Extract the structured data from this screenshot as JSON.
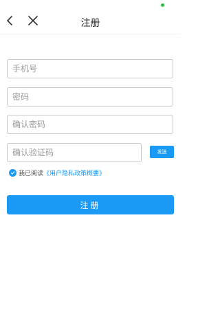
{
  "colors": {
    "accent": "#1a9af5",
    "status_dot": "#2fbf3f"
  },
  "header": {
    "title": "注册",
    "back_icon": "chevron-left-icon",
    "close_icon": "close-icon"
  },
  "form": {
    "phone_placeholder": "手机号",
    "password_placeholder": "密码",
    "confirm_password_placeholder": "确认密码",
    "verification_code_placeholder": "确认验证码",
    "send_label": "发送"
  },
  "agreement": {
    "checked": true,
    "prefix": "我已阅读",
    "link": "《用户隐私政策概要》"
  },
  "submit_label": "注册"
}
